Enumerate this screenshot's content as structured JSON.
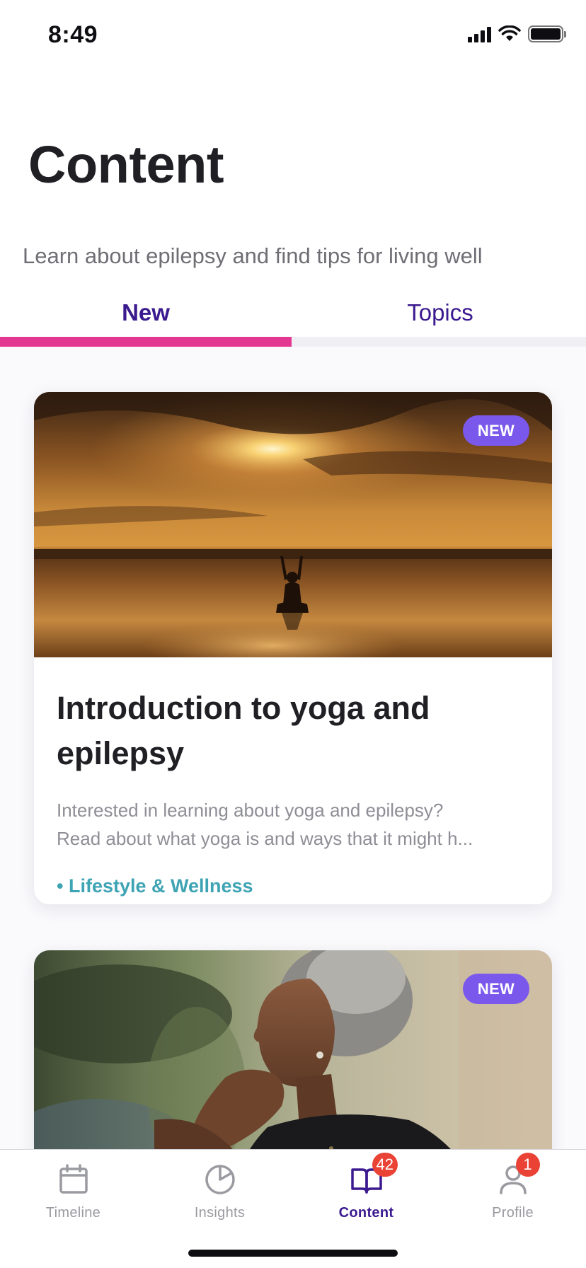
{
  "status_bar": {
    "time": "8:49"
  },
  "header": {
    "title": "Content",
    "subtitle": "Learn about epilepsy and find tips for living well"
  },
  "tabs": [
    {
      "label": "New",
      "selected": true
    },
    {
      "label": "Topics",
      "selected": false
    }
  ],
  "cards": [
    {
      "badge": "NEW",
      "image": "sunset-yoga-beach-photo",
      "title": "Introduction to yoga and epilepsy",
      "description_line1": "Interested in learning about yoga and epilepsy?",
      "description_line2": "Read about what yoga is and ways that it might h...",
      "tag": "• Lifestyle & Wellness"
    },
    {
      "badge": "NEW",
      "image": "woman-thinking-photo"
    }
  ],
  "bottom_nav": [
    {
      "label": "Timeline",
      "icon": "calendar-icon",
      "active": false
    },
    {
      "label": "Insights",
      "icon": "pie-chart-icon",
      "active": false
    },
    {
      "label": "Content",
      "icon": "book-icon",
      "active": true,
      "badge": "42"
    },
    {
      "label": "Profile",
      "icon": "person-icon",
      "active": false,
      "badge": "1"
    }
  ],
  "colors": {
    "accent_purple": "#3b1a8f",
    "tab_indicator_pink": "#e33892",
    "badge_violet": "#7b58ec",
    "tag_teal": "#3ea4b4",
    "notification_red": "#ea4335"
  }
}
